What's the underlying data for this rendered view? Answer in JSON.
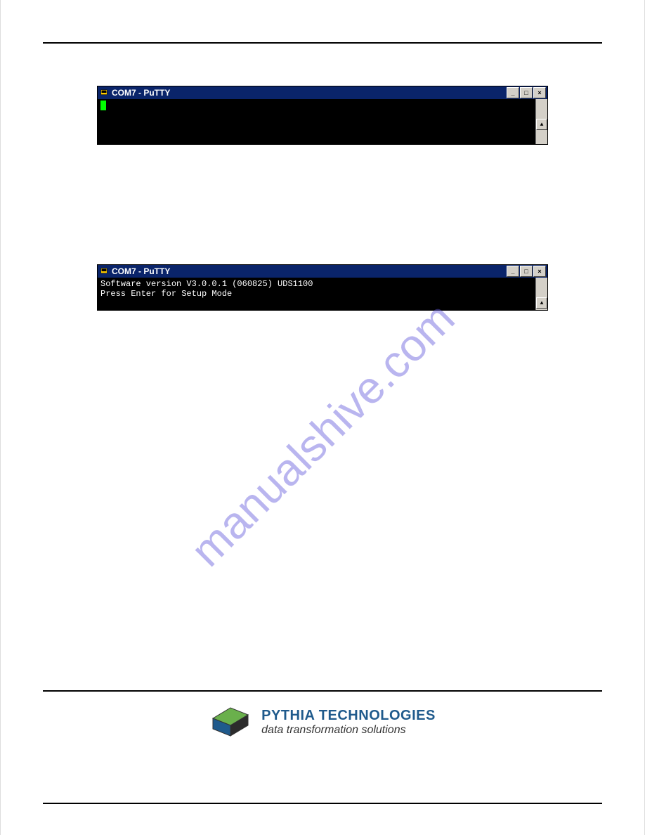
{
  "window1": {
    "title": "COM7 - PuTTY",
    "body": ""
  },
  "window2": {
    "title": "COM7 - PuTTY",
    "body": "Software version V3.0.0.1 (060825) UDS1100\nPress Enter for Setup Mode"
  },
  "watermark": "manualshive.com",
  "footer": {
    "company": "PYTHIA TECHNOLOGIES",
    "tagline": "data transformation solutions"
  },
  "winbtns": {
    "min": "_",
    "max": "□",
    "close": "×"
  }
}
